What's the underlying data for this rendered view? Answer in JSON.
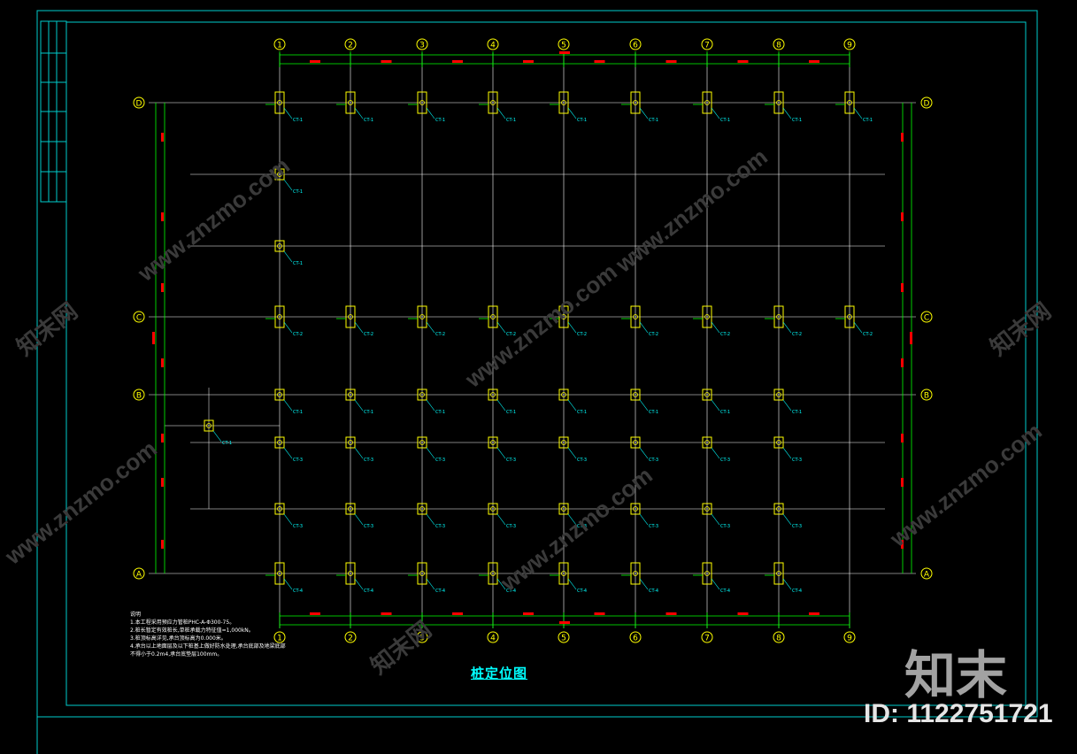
{
  "drawing": {
    "title": "桩定位图",
    "notes_heading": "说明",
    "notes": [
      "1.本工程采用预应力管桩PHC-A-Φ300-75。",
      "2.桩长暂定有效桩长,单桩承载力特征值=1,000kN。",
      "3.桩顶标高详见,承台顶标高为0.000米。",
      "4.承台以上地面层及以下桩基上做好防水处理,承台底部及地梁底部",
      "  不得小于0.2m4,承台底垫层100mm。"
    ],
    "column_axes": [
      "1",
      "2",
      "3",
      "4",
      "5",
      "6",
      "7",
      "8",
      "9"
    ],
    "row_axes": [
      "D",
      "C",
      "B",
      "A"
    ],
    "pile_labels": [
      "CT-1",
      "CT-2",
      "CT-3",
      "CT-4"
    ],
    "dim_top": "8000",
    "dim_total": "64000",
    "dim_side": "36000"
  },
  "watermark": {
    "site": "www.znzmo.com",
    "brand": "知末网",
    "logo": "知末",
    "id": "ID: 1122751721"
  },
  "colors": {
    "background": "#000000",
    "frame": "#00ffff",
    "grid": "#ffffff",
    "dimension": "#00ff00",
    "pile": "#ffff00",
    "label": "#00ffff",
    "dim_text": "#ff0000"
  }
}
